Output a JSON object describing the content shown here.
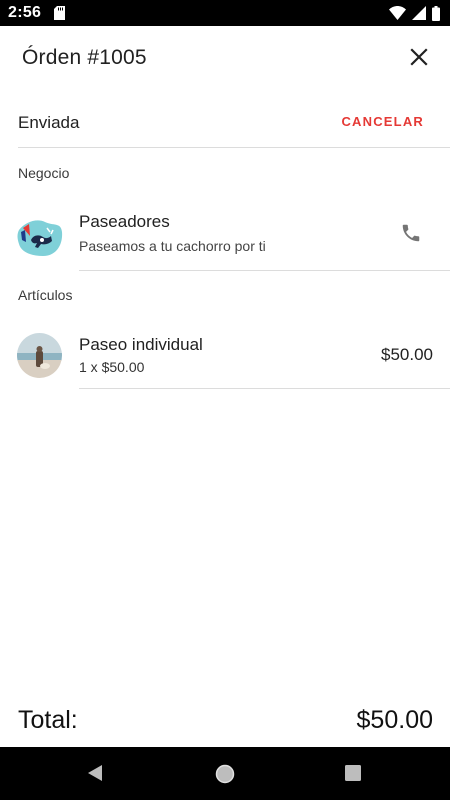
{
  "status_bar": {
    "time": "2:56",
    "icons": [
      "sd-card-icon",
      "wifi-icon",
      "signal-icon",
      "battery-icon"
    ]
  },
  "header": {
    "title": "Órden #1005",
    "close_icon": "close-icon"
  },
  "order_status": {
    "label": "Enviada",
    "cancel_label": "CANCELAR"
  },
  "business_section": {
    "title": "Negocio",
    "name": "Paseadores",
    "description": "Paseamos a tu cachorro por ti",
    "call_icon": "phone-icon"
  },
  "items_section": {
    "title": "Artículos",
    "items": [
      {
        "name": "Paseo individual",
        "quantity_text": "1 x $50.00",
        "price": "$50.00"
      }
    ]
  },
  "total": {
    "label": "Total:",
    "value": "$50.00"
  },
  "nav_bar": {
    "icons": [
      "back-icon",
      "home-icon",
      "recents-icon"
    ]
  },
  "colors": {
    "accent_cancel": "#e53935",
    "divider": "#dcdcdc",
    "icon_gray": "#757575"
  }
}
